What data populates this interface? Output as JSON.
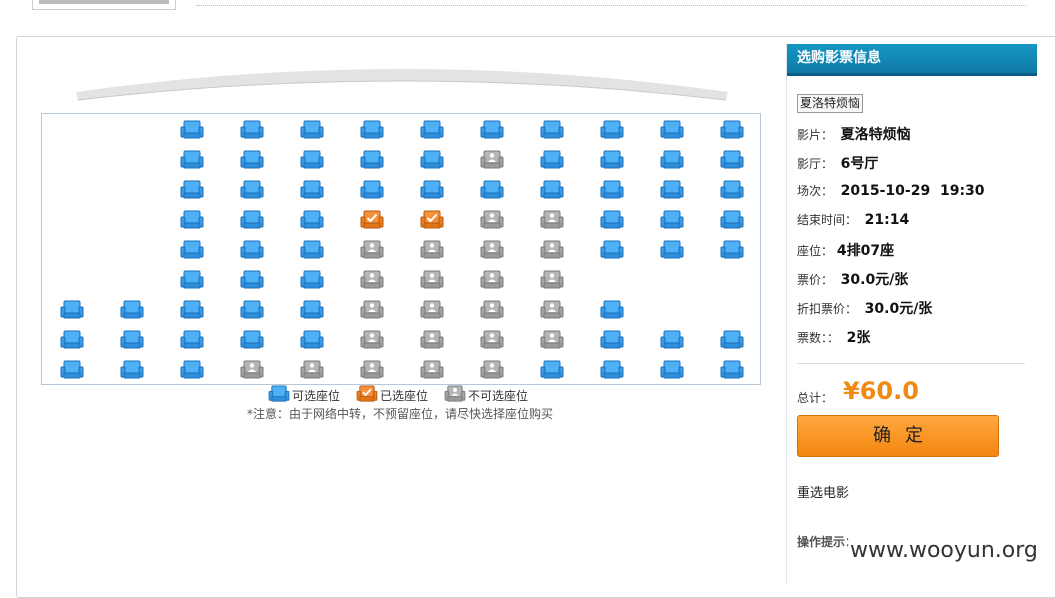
{
  "seat_grid": {
    "rows": [
      "__AAAAAAAAAA",
      "__AAAAAUAAAA",
      "__AAAAAAAAAA",
      "__AAASSUUAAA",
      "__AAAUUUUAAA",
      "__AAAUUUU___",
      "AAAAAUUUUA__",
      "AAAAAUUUUAAA",
      "AAAUUUUUAAAA"
    ],
    "legend": [
      "A",
      "S",
      "U"
    ]
  },
  "colors": {
    "available": "#3aa0ec",
    "selected": "#f0842b",
    "unavailable": "#a8a8a8",
    "header": "#1187b8",
    "price": "#f08a14"
  },
  "legend": {
    "available_label": "可选座位",
    "selected_label": "已选座位",
    "unavailable_label": "不可选座位"
  },
  "notice": "*注意：由于网络中转，不预留座位，请尽快选择座位购买",
  "info": {
    "title": "选购影票信息",
    "movie_tag": "夏洛特烦恼",
    "movie_label": "影片：",
    "movie_value": "夏洛特烦恼",
    "hall_label": "影厅：",
    "hall_value": "6号厅",
    "session_label": "场次：",
    "session_value": "2015-10-29  19:30",
    "end_label": "结束时间：",
    "end_value": "21:14",
    "seat_label": "座位：",
    "seat_value": "4排07座",
    "price_label": "票价：",
    "price_value": "30.0元/张",
    "discount_label": "折扣票价：",
    "discount_value": "30.0元/张",
    "count_label": "票数：：",
    "count_value": "2张",
    "total_label": "总计：",
    "total_value": "¥60.0",
    "confirm_label": "确定",
    "reselect_label": "重选电影",
    "tips_label": "操作提示："
  },
  "watermark": "www.wooyun.org"
}
